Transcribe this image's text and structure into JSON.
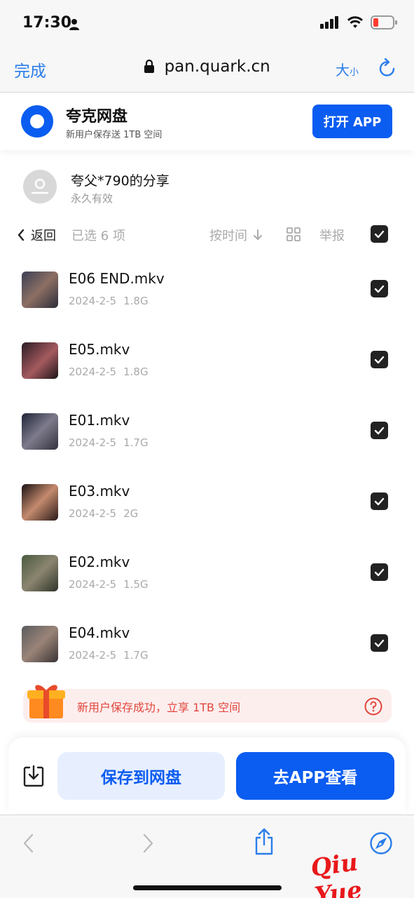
{
  "status_bar": {
    "time": "17:30"
  },
  "browser": {
    "done_label": "完成",
    "url": "pan.quark.cn",
    "size_label_large": "大",
    "size_label_small": "小"
  },
  "banner": {
    "title": "夸克网盘",
    "subtitle": "新用户保存送 1TB 空间",
    "open_app_label": "打开 APP"
  },
  "share": {
    "owner": "夸父*790的分享",
    "validity": "永久有效"
  },
  "toolbar": {
    "back_label": "返回",
    "selected_label": "已选 6 项",
    "sort_label": "按时间",
    "report_label": "举报"
  },
  "files": [
    {
      "name": "E06 END.mkv",
      "date": "2024-2-5",
      "size": "1.8G"
    },
    {
      "name": "E05.mkv",
      "date": "2024-2-5",
      "size": "1.8G"
    },
    {
      "name": "E01.mkv",
      "date": "2024-2-5",
      "size": "1.7G"
    },
    {
      "name": "E03.mkv",
      "date": "2024-2-5",
      "size": "2G"
    },
    {
      "name": "E02.mkv",
      "date": "2024-2-5",
      "size": "1.5G"
    },
    {
      "name": "E04.mkv",
      "date": "2024-2-5",
      "size": "1.7G"
    }
  ],
  "promo": {
    "text": "新用户保存成功，立享 1TB 空间"
  },
  "actions": {
    "save_label": "保存到网盘",
    "view_label": "去APP查看"
  },
  "watermark": "Qiu Yue",
  "colors": {
    "brand": "#0b5cf0",
    "link": "#2b7de9",
    "promo_text": "#e0473d",
    "checkbox": "#222222"
  }
}
